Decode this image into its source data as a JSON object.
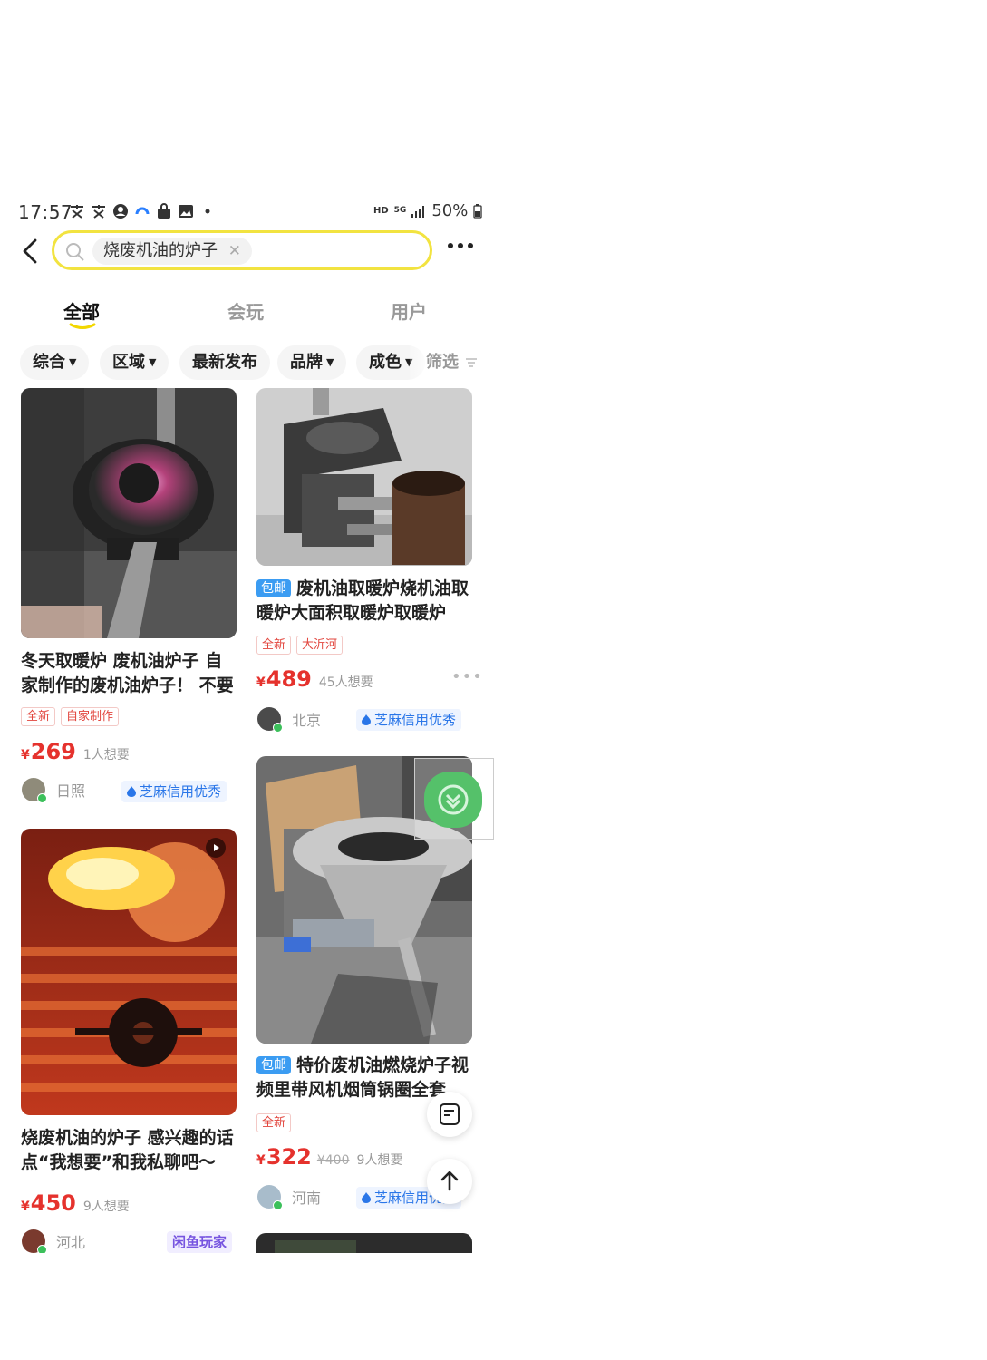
{
  "status_bar": {
    "time": "17:57",
    "network": "HD",
    "network_type": "5G",
    "battery": "50%"
  },
  "search": {
    "query": "烧废机油的炉子",
    "clear_icon": "close-icon"
  },
  "tabs": [
    {
      "label": "全部",
      "active": true
    },
    {
      "label": "会玩",
      "active": false
    },
    {
      "label": "用户",
      "active": false
    }
  ],
  "filters": {
    "items": [
      {
        "label": "综合"
      },
      {
        "label": "区域"
      },
      {
        "label": "最新发布"
      },
      {
        "label": "品牌"
      },
      {
        "label": "成色"
      }
    ],
    "screen_label": "筛选"
  },
  "items": [
    {
      "title": "冬天取暖炉 废机油炉子 自家制作的废机油炉子！ 不要",
      "tags": [
        "全新",
        "自家制作"
      ],
      "price": "269",
      "currency": "¥",
      "want": "1人想要",
      "location": "日照",
      "credit": "芝麻信用优秀"
    },
    {
      "badge": "包邮",
      "title": "废机油取暖炉烧机油取暖炉大面积取暖炉取暖炉",
      "tags": [
        "全新",
        "大沂河"
      ],
      "price": "489",
      "currency": "¥",
      "want": "45人想要",
      "location": "北京",
      "credit": "芝麻信用优秀"
    },
    {
      "title": "烧废机油的炉子 感兴趣的话点“我想要”和我私聊吧～",
      "price": "450",
      "currency": "¥",
      "want": "9人想要",
      "location": "河北",
      "badge_player": "闲鱼玩家"
    },
    {
      "badge": "包邮",
      "title": "特价废机油燃烧炉子视频里带风机烟筒锅圈全套",
      "tags": [
        "全新"
      ],
      "price": "322",
      "currency": "¥",
      "original_price": "¥400",
      "want": "9人想要",
      "location": "河南",
      "credit": "芝麻信用优秀"
    }
  ]
}
